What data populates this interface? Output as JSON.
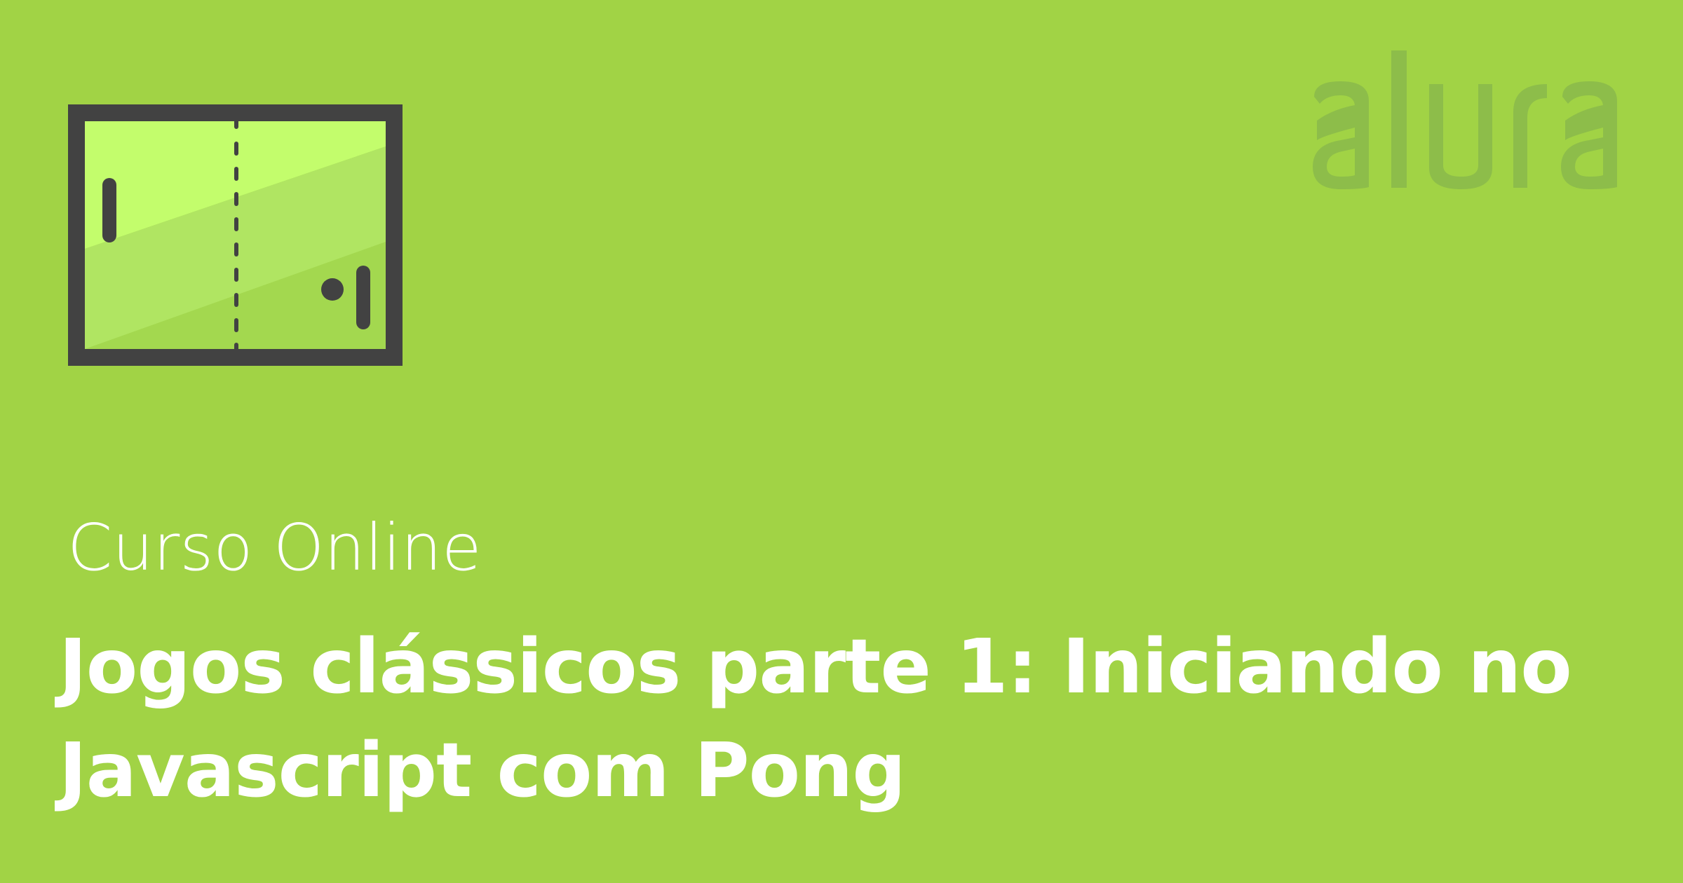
{
  "card": {
    "background_color": "#a1d345",
    "icon": "pong-game-icon",
    "brand": {
      "logo_text": "alura",
      "logo_color": "#8dbd4a"
    },
    "subtitle": "Curso Online",
    "title_lines": [
      "Jogos clássicos parte 1: Iniciando no",
      "Javascript com Pong"
    ]
  }
}
